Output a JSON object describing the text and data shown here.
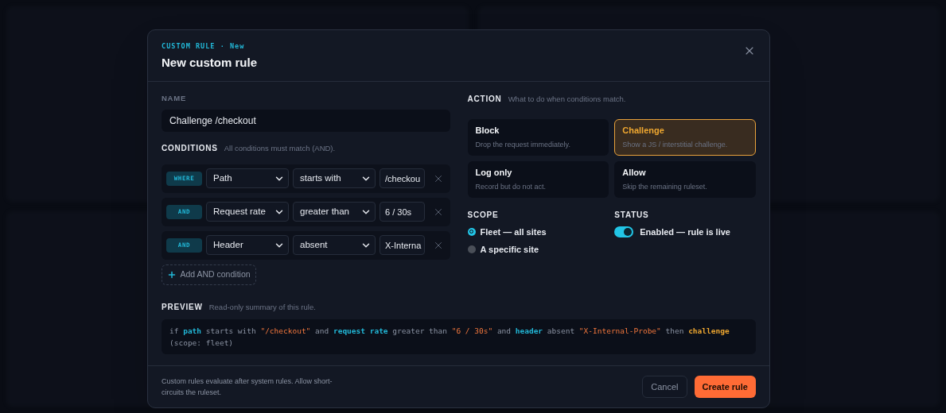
{
  "dialog": {
    "eyebrow": "CUSTOM RULE · New",
    "title": "New custom rule"
  },
  "name": {
    "label": "NAME",
    "value": "Challenge /checkout"
  },
  "conditions": {
    "label": "CONDITIONS",
    "hint": "All conditions must match (AND).",
    "rows": [
      {
        "connector": "WHERE",
        "field": "Path",
        "operator": "starts with",
        "value": "/checkou"
      },
      {
        "connector": "AND",
        "field": "Request rate",
        "operator": "greater than",
        "value": "6 / 30s"
      },
      {
        "connector": "AND",
        "field": "Header",
        "operator": "absent",
        "value": "X-Interna"
      }
    ],
    "add_button": "Add AND condition"
  },
  "action": {
    "label": "ACTION",
    "hint": "What to do when conditions match.",
    "options": [
      {
        "title": "Block",
        "description": "Drop the request immediately.",
        "selected": false
      },
      {
        "title": "Challenge",
        "description": "Show a JS / interstitial challenge.",
        "selected": true
      },
      {
        "title": "Log only",
        "description": "Record but do not act.",
        "selected": false
      },
      {
        "title": "Allow",
        "description": "Skip the remaining ruleset.",
        "selected": false
      }
    ]
  },
  "scope": {
    "label": "SCOPE",
    "options": [
      {
        "label": "Fleet — all sites",
        "selected": true
      },
      {
        "label": "A specific site",
        "selected": false
      }
    ]
  },
  "status": {
    "label": "STATUS",
    "text": "Enabled — rule is live",
    "on": true
  },
  "preview": {
    "label": "PREVIEW",
    "hint": "Read-only summary of this rule.",
    "tokens": [
      {
        "text": "if ",
        "kind": "plain"
      },
      {
        "text": "path",
        "kind": "field"
      },
      {
        "text": " starts with ",
        "kind": "plain"
      },
      {
        "text": "\"/checkout\"",
        "kind": "value"
      },
      {
        "text": " and ",
        "kind": "plain"
      },
      {
        "text": "request rate",
        "kind": "field"
      },
      {
        "text": " greater than ",
        "kind": "plain"
      },
      {
        "text": "\"6 / 30s\"",
        "kind": "value"
      },
      {
        "text": " and ",
        "kind": "plain"
      },
      {
        "text": "header",
        "kind": "field"
      },
      {
        "text": " absent ",
        "kind": "plain"
      },
      {
        "text": "\"X-Internal-Probe\"",
        "kind": "value"
      },
      {
        "text": " then ",
        "kind": "plain"
      },
      {
        "text": "challenge",
        "kind": "action"
      },
      {
        "text": " (scope: fleet)",
        "kind": "plain"
      }
    ]
  },
  "footer": {
    "note": "Custom rules evaluate after system rules. Allow short-circuits the ruleset.",
    "buttons": [
      {
        "label": "Cancel",
        "kind": "secondary"
      },
      {
        "label": "Create rule",
        "kind": "primary"
      }
    ]
  }
}
